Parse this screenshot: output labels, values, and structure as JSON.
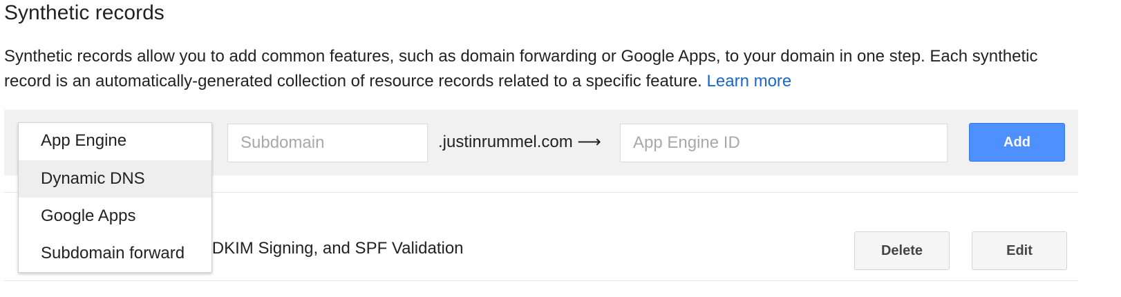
{
  "section": {
    "title": "Synthetic records",
    "description": "Synthetic records allow you to add common features, such as domain forwarding or Google Apps, to your domain in one step. Each synthetic record is an automatically-generated collection of resource records related to a specific feature.",
    "learn_more": "Learn more"
  },
  "add_form": {
    "subdomain_placeholder": "Subdomain",
    "domain_suffix": ".justinrummel.com ⟶",
    "id_placeholder": "App Engine ID",
    "add_label": "Add"
  },
  "dropdown": {
    "selected": "App Engine",
    "items": [
      {
        "label": "App Engine"
      },
      {
        "label": "Dynamic DNS"
      },
      {
        "label": "Google Apps"
      },
      {
        "label": "Subdomain forward"
      }
    ]
  },
  "record": {
    "text": "s, calendar, docs, mail, DKIM Signing, and SPF Validation",
    "delete_label": "Delete",
    "edit_label": "Edit"
  },
  "colors": {
    "link": "#1a66c9",
    "primary_button": "#4d90fe",
    "panel_bg": "#f1f1f1"
  }
}
